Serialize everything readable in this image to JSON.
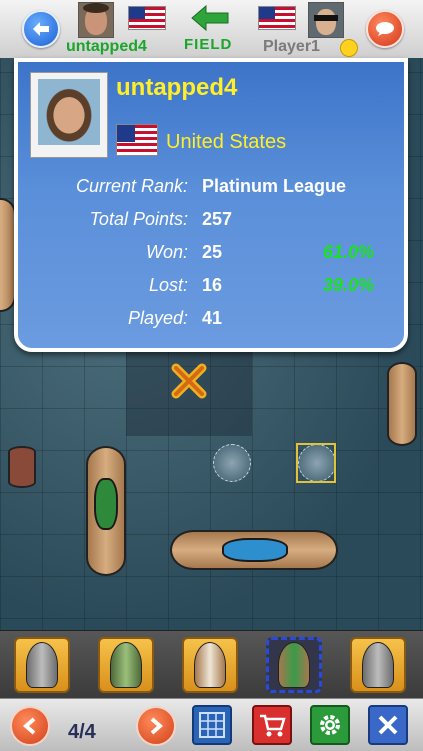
{
  "header": {
    "player_left_name": "untapped4",
    "field_label": "FIELD",
    "player_right_name": "Player1"
  },
  "profile": {
    "name": "untapped4",
    "country": "United States",
    "stats": [
      {
        "label": "Current Rank:",
        "value": "Platinum League",
        "pct": ""
      },
      {
        "label": "Total Points:",
        "value": "257",
        "pct": ""
      },
      {
        "label": "Won:",
        "value": "25",
        "pct": "61.0%"
      },
      {
        "label": "Lost:",
        "value": "16",
        "pct": "39.0%"
      },
      {
        "label": "Played:",
        "value": "41",
        "pct": ""
      }
    ]
  },
  "footer": {
    "page_indicator": "4/4"
  },
  "colors": {
    "player_left_name": "#1ba52a",
    "player_right_name": "#7b7b7b",
    "profile_name": "#ffee2a",
    "percentage": "#19e31e"
  },
  "icons": {
    "back": "back-arrow-icon",
    "chat": "chat-bubble-icon",
    "field_arrow": "left-arrow-icon",
    "prev": "chevron-left-icon",
    "next": "chevron-right-icon",
    "grid": "grid-icon",
    "cart": "cart-icon",
    "settings": "gear-icon",
    "close": "close-icon"
  }
}
